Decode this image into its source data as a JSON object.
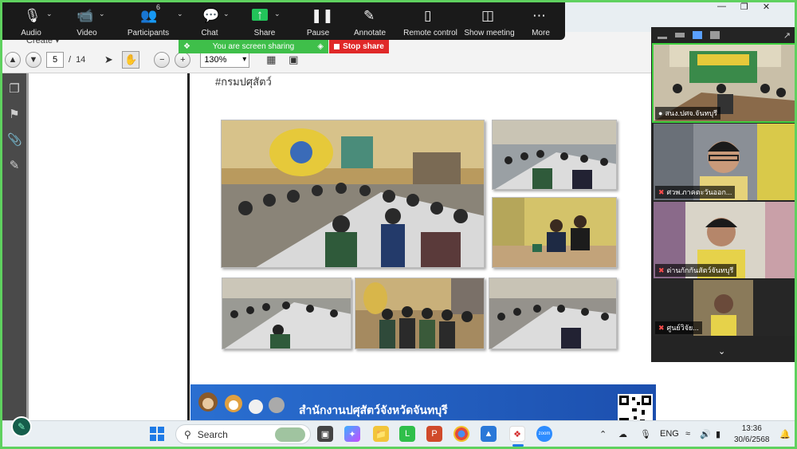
{
  "zoom_toolbar": {
    "items": [
      {
        "label": "Audio",
        "icon": "microphone-icon"
      },
      {
        "label": "Video",
        "icon": "video-camera-icon"
      },
      {
        "label": "Participants",
        "icon": "participants-icon",
        "count": "6"
      },
      {
        "label": "Chat",
        "icon": "chat-icon"
      },
      {
        "label": "Share",
        "icon": "share-screen-icon"
      },
      {
        "label": "Pause",
        "icon": "pause-icon"
      },
      {
        "label": "Annotate",
        "icon": "pen-icon"
      },
      {
        "label": "Remote control",
        "icon": "mouse-icon"
      },
      {
        "label": "Show meeting",
        "icon": "meeting-window-icon"
      },
      {
        "label": "More",
        "icon": "more-dots-icon"
      }
    ]
  },
  "share_banner": {
    "text": "You are screen sharing",
    "stop_label": "Stop share"
  },
  "pdf": {
    "create_label": "Create",
    "page_current": "5",
    "page_separator": "/",
    "page_total": "14",
    "zoom_value": "130%",
    "hashtag": "#กรมปศุสัตว์",
    "banner_text": "สำนักงานปศุสัตว์จังหวัดจันทบุรี"
  },
  "gallery": {
    "participants": [
      {
        "name": "สนง.ปศจ.จันทบุรี",
        "mic": "on",
        "active": true
      },
      {
        "name": "ศวพ.ภาคตะวันออก...",
        "mic": "off",
        "active": false
      },
      {
        "name": "ด่านกักกันสัตว์จันทบุรี",
        "mic": "off",
        "active": false
      },
      {
        "name": "ศูนย์วิจัย...",
        "mic": "off",
        "active": false
      }
    ]
  },
  "taskbar": {
    "search_placeholder": "Search",
    "language": "ENG",
    "time": "13:36",
    "date": "30/6/2568"
  },
  "colors": {
    "share_green": "#3fbf4a",
    "stop_red": "#e02828",
    "frame_green": "#5fd15f",
    "toolbar_bg": "#1a1a1a"
  }
}
